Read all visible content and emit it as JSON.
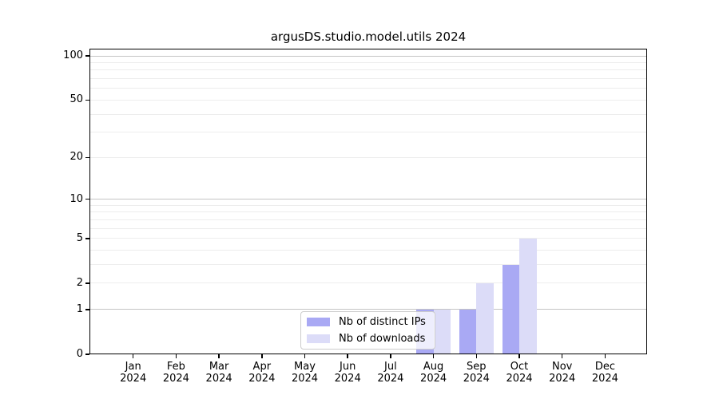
{
  "title": "argusDS.studio.model.utils 2024",
  "chart_data": {
    "type": "bar",
    "title": "argusDS.studio.model.utils 2024",
    "categories": [
      "Jan",
      "Feb",
      "Mar",
      "Apr",
      "May",
      "Jun",
      "Jul",
      "Aug",
      "Sep",
      "Oct",
      "Nov",
      "Dec"
    ],
    "year_label": "2024",
    "series": [
      {
        "name": "Nb of distinct IPs",
        "color": "#a9a9f4",
        "values": [
          0,
          0,
          0,
          0,
          0,
          0,
          0,
          1,
          1,
          3,
          0,
          0
        ]
      },
      {
        "name": "Nb of downloads",
        "color": "#dcdcf8",
        "values": [
          0,
          0,
          0,
          0,
          0,
          0,
          0,
          1,
          2,
          5,
          0,
          0
        ]
      }
    ],
    "yscale": "log1p",
    "ylim": [
      0,
      112
    ],
    "yticks": [
      0,
      1,
      2,
      5,
      10,
      20,
      50,
      100
    ],
    "major_gridlines": [
      1,
      10,
      100
    ],
    "minor_gridlines": [
      2,
      3,
      4,
      5,
      6,
      7,
      8,
      9,
      20,
      30,
      40,
      50,
      60,
      70,
      80,
      90
    ],
    "grid": true,
    "legend_position": "lower center",
    "xlabel": "",
    "ylabel": ""
  },
  "colors": {
    "background": "#ffffff",
    "spine": "#000000",
    "grid_major": "#c4c4c4",
    "grid_minor": "#ededed",
    "tick_label": "#000000",
    "legend_border": "#cccccc",
    "legend_background": "rgba(255,255,255,0.8)"
  }
}
